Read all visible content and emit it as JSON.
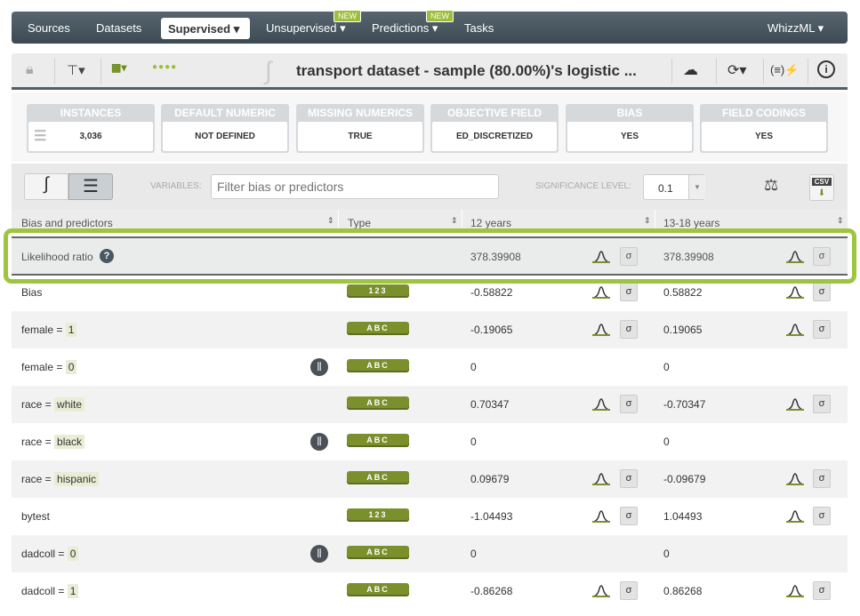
{
  "nav": {
    "items": [
      "Sources",
      "Datasets",
      "Supervised",
      "Unsupervised",
      "Predictions",
      "Tasks",
      "WhizzML"
    ],
    "new_badge": "NEW"
  },
  "toolbar": {
    "title": "transport dataset - sample (80.00%)'s logistic ..."
  },
  "summary": [
    {
      "label": "INSTANCES",
      "value": "3,036"
    },
    {
      "label": "DEFAULT NUMERIC",
      "value": "NOT DEFINED"
    },
    {
      "label": "MISSING NUMERICS",
      "value": "TRUE"
    },
    {
      "label": "OBJECTIVE FIELD",
      "value": "ED_DISCRETIZED"
    },
    {
      "label": "BIAS",
      "value": "YES"
    },
    {
      "label": "FIELD CODINGS",
      "value": "YES"
    }
  ],
  "controls": {
    "variables_label": "VARIABLES:",
    "filter_placeholder": "Filter bias or predictors",
    "significance_label": "SIGNIFICANCE LEVEL:",
    "significance_value": "0.1",
    "csv_label": "CSV"
  },
  "table": {
    "headers": [
      "Bias and predictors",
      "Type",
      "12 years",
      "13-18 years"
    ],
    "likelihood": {
      "label": "Likelihood ratio",
      "v1": "378.39908",
      "v2": "378.39908"
    },
    "sigma": "σ",
    "rows": [
      {
        "name": "Bias",
        "cat": "",
        "type": "123",
        "v1": "-0.58822",
        "v2": "0.58822",
        "dist": true,
        "filter": false
      },
      {
        "name": "female =",
        "cat": "1",
        "type": "ABC",
        "v1": "-0.19065",
        "v2": "0.19065",
        "dist": true,
        "filter": false
      },
      {
        "name": "female =",
        "cat": "0",
        "type": "ABC",
        "v1": "0",
        "v2": "0",
        "dist": false,
        "filter": true
      },
      {
        "name": "race =",
        "cat": "white",
        "type": "ABC",
        "v1": "0.70347",
        "v2": "-0.70347",
        "dist": true,
        "filter": false
      },
      {
        "name": "race =",
        "cat": "black",
        "type": "ABC",
        "v1": "0",
        "v2": "0",
        "dist": false,
        "filter": true
      },
      {
        "name": "race =",
        "cat": "hispanic",
        "type": "ABC",
        "v1": "0.09679",
        "v2": "-0.09679",
        "dist": true,
        "filter": false
      },
      {
        "name": "bytest",
        "cat": "",
        "type": "123",
        "v1": "-1.04493",
        "v2": "1.04493",
        "dist": true,
        "filter": false
      },
      {
        "name": "dadcoll =",
        "cat": "0",
        "type": "ABC",
        "v1": "0",
        "v2": "0",
        "dist": false,
        "filter": true
      },
      {
        "name": "dadcoll =",
        "cat": "1",
        "type": "ABC",
        "v1": "-0.86268",
        "v2": "0.86268",
        "dist": true,
        "filter": false
      }
    ]
  },
  "colors": {
    "accent": "#9ebd3a",
    "nav": "#4a5862",
    "badge": "#7b902d"
  }
}
